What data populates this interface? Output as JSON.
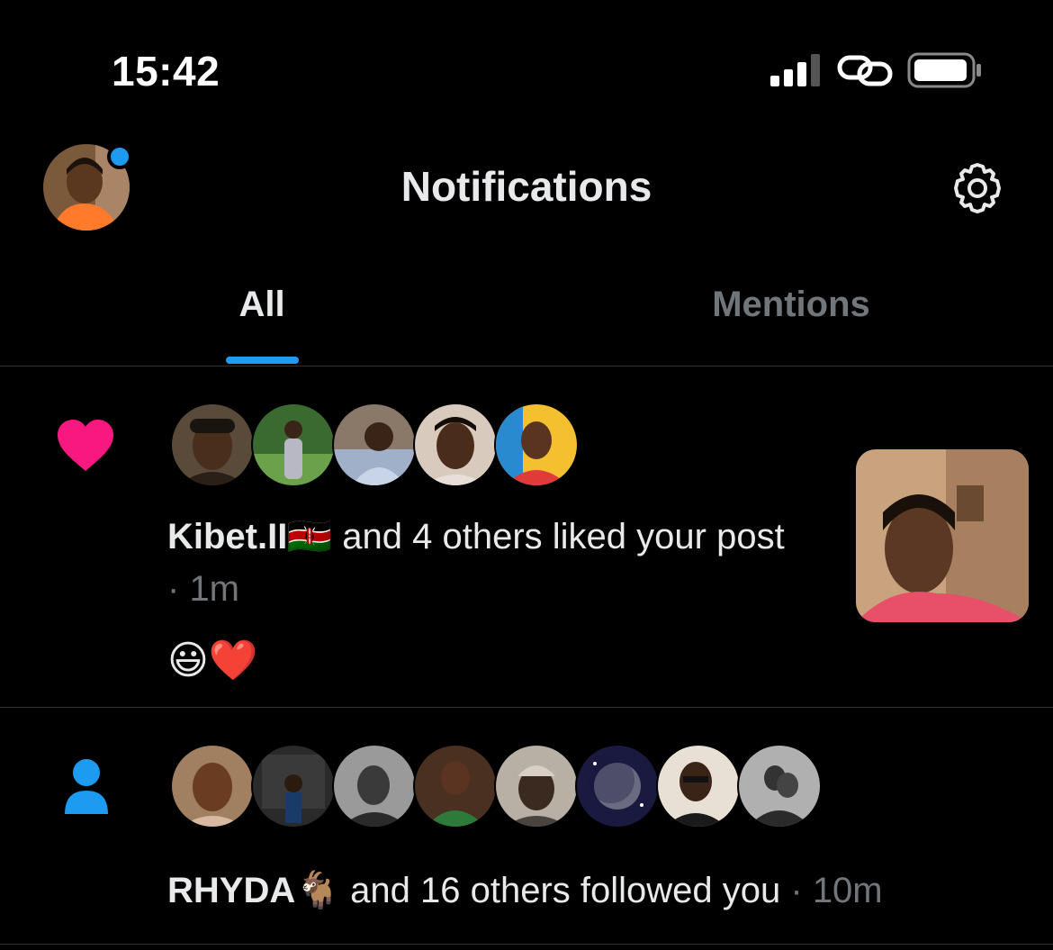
{
  "status_bar": {
    "time": "15:42",
    "signal_bars": 3,
    "battery_level": 0.85
  },
  "header": {
    "title": "Notifications",
    "profile_avatar": "user-avatar",
    "settings_icon": "gear-icon"
  },
  "tabs": [
    {
      "label": "All",
      "active": true
    },
    {
      "label": "Mentions",
      "active": false
    }
  ],
  "notifications": [
    {
      "type": "like",
      "icon": "heart-icon",
      "icon_color": "#f91880",
      "avatar_count": 5,
      "actor": "Kibet.II",
      "actor_flag": "🇰🇪",
      "text": " and 4 others liked your post",
      "time": "1m",
      "post_text": "😃❤️",
      "has_thumbnail": true
    },
    {
      "type": "follow",
      "icon": "person-icon",
      "icon_color": "#1d9bf0",
      "avatar_count": 8,
      "actor": "RHYDA",
      "actor_emoji": "🐐",
      "text": " and 16 others followed you",
      "time": "10m"
    }
  ],
  "colors": {
    "accent": "#1d9bf0",
    "like": "#f91880",
    "muted": "#71767b",
    "divider": "#2f3336"
  }
}
